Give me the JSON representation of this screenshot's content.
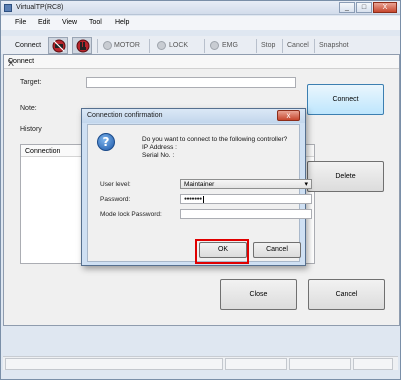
{
  "window": {
    "title": "VirtualTP(RC8)",
    "min": "_",
    "max": "□",
    "close": "X"
  },
  "menu": {
    "items": [
      "File",
      "Edit",
      "View",
      "Tool",
      "Help"
    ]
  },
  "toolbar": {
    "connect": "Connect",
    "motor": "MOTOR",
    "lock": "LOCK",
    "emg": "EMG",
    "stop": "Stop",
    "cancel": "Cancel",
    "snapshot": "Snapshot"
  },
  "connect_panel": {
    "title": "Connect",
    "close": "X",
    "target_label": "Target:",
    "note_label": "Note:",
    "history_label": "History",
    "list_header": "Connection",
    "connect_button": "Connect",
    "delete_button": "Delete",
    "close_button": "Close",
    "cancel_button": "Cancel"
  },
  "dialog": {
    "title": "Connection confirmation",
    "close": "x",
    "message_line1": "Do you want to connect to the following controller?",
    "message_line2": "IP Address :",
    "message_line3": "Serial No. :",
    "user_level_label": "User level:",
    "user_level_value": "Maintainer",
    "password_label": "Password:",
    "password_dots": "●●●●●●●",
    "mode_lock_label": "Mode lock Password:",
    "ok_button": "OK",
    "cancel_button": "Cancel"
  },
  "colors": {
    "highlight": "#e00000",
    "accent": "#3c7fb1"
  },
  "icons": [
    "question-icon",
    "connect-icon",
    "stop-hand-icon",
    "window-close-icon",
    "dropdown-arrow-icon"
  ]
}
